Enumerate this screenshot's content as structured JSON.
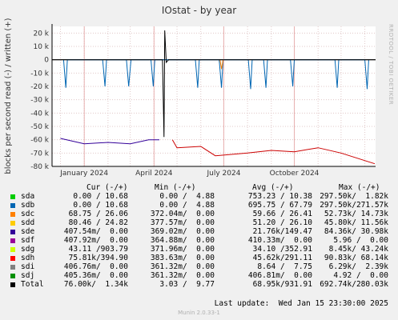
{
  "title": "IOstat - by year",
  "side_label": "RRDTOOL / TOBI OETIKER",
  "chart_data": {
    "type": "line",
    "title": "IOstat - by year",
    "ylabel": "blocks per second read (-) / written (+)",
    "ylim": [
      -80000,
      25000
    ],
    "y_ticks": [
      20000,
      10000,
      0,
      -10000,
      -20000,
      -30000,
      -40000,
      -50000,
      -60000,
      -70000,
      -80000
    ],
    "y_tick_labels": [
      "20 k",
      "10 k",
      "0",
      "-10 k",
      "-20 k",
      "-30 k",
      "-40 k",
      "-50 k",
      "-60 k",
      "-70 k",
      "-80 k"
    ],
    "x_tick_labels": [
      "January 2024",
      "April 2024",
      "July 2024",
      "October 2024"
    ],
    "x_range": [
      "2023-11-20",
      "2025-01-15"
    ],
    "grid": true,
    "series": [
      {
        "name": "sdh",
        "color": "#CC0000",
        "points": [
          [
            "2024-04-25",
            -60000
          ],
          [
            "2024-05-01",
            -66000
          ],
          [
            "2024-06-01",
            -65000
          ],
          [
            "2024-06-20",
            -72000
          ],
          [
            "2024-08-01",
            -70000
          ],
          [
            "2024-09-01",
            -68000
          ],
          [
            "2024-10-01",
            -69000
          ],
          [
            "2024-11-01",
            -66000
          ],
          [
            "2024-12-01",
            -70000
          ],
          [
            "2025-01-14",
            -78000
          ]
        ]
      },
      {
        "name": "sde",
        "color": "#330099",
        "points": [
          [
            "2023-12-01",
            -59000
          ],
          [
            "2024-01-01",
            -63000
          ],
          [
            "2024-02-01",
            -62000
          ],
          [
            "2024-03-01",
            -63000
          ],
          [
            "2024-03-25",
            -60000
          ],
          [
            "2024-04-08",
            -60000
          ]
        ]
      },
      {
        "name": "sdb",
        "color": "#0066B3",
        "points": [
          [
            "2023-12-05",
            0
          ],
          [
            "2023-12-08",
            -21000
          ],
          [
            "2023-12-10",
            0
          ],
          [
            "2024-01-25",
            0
          ],
          [
            "2024-01-28",
            -20000
          ],
          [
            "2024-01-30",
            0
          ],
          [
            "2024-02-25",
            0
          ],
          [
            "2024-02-28",
            -20000
          ],
          [
            "2024-03-02",
            0
          ],
          [
            "2024-03-28",
            0
          ],
          [
            "2024-03-31",
            -20000
          ],
          [
            "2024-04-02",
            0
          ],
          [
            "2024-05-25",
            0
          ],
          [
            "2024-05-28",
            -21000
          ],
          [
            "2024-05-30",
            0
          ],
          [
            "2024-06-25",
            0
          ],
          [
            "2024-06-28",
            -21000
          ],
          [
            "2024-06-30",
            0
          ],
          [
            "2024-08-02",
            0
          ],
          [
            "2024-08-05",
            -22000
          ],
          [
            "2024-08-07",
            0
          ],
          [
            "2024-08-22",
            0
          ],
          [
            "2024-08-25",
            -21000
          ],
          [
            "2024-08-27",
            0
          ],
          [
            "2024-09-26",
            0
          ],
          [
            "2024-09-29",
            -20000
          ],
          [
            "2024-10-01",
            0
          ],
          [
            "2024-11-23",
            0
          ],
          [
            "2024-11-26",
            -21000
          ],
          [
            "2024-11-28",
            0
          ],
          [
            "2025-01-01",
            0
          ],
          [
            "2025-01-04",
            -22000
          ],
          [
            "2025-01-06",
            0
          ]
        ]
      },
      {
        "name": "sdc",
        "color": "#FF8000",
        "points": [
          [
            "2024-06-26",
            0
          ],
          [
            "2024-06-28",
            -7000
          ],
          [
            "2024-06-30",
            0
          ]
        ]
      },
      {
        "name": "Total",
        "color": "#000000",
        "points": [
          [
            "2023-11-20",
            0
          ],
          [
            "2024-04-12",
            0
          ],
          [
            "2024-04-14",
            -58000
          ],
          [
            "2024-04-15",
            22000
          ],
          [
            "2024-04-17",
            -2000
          ],
          [
            "2024-04-20",
            0
          ],
          [
            "2025-01-15",
            0
          ]
        ]
      }
    ]
  },
  "legend": {
    "header": {
      "cur": "Cur (-/+)",
      "min": "Min (-/+)",
      "avg": "Avg (-/+)",
      "max": "Max (-/+)"
    },
    "rows": [
      {
        "name": "sda",
        "color": "#00CC00",
        "cur": "0.00 / 10.68",
        "min": "0.00 /  4.88",
        "avg": "753.23 / 10.38",
        "max": "297.50k/  1.82k"
      },
      {
        "name": "sdb",
        "color": "#0066B3",
        "cur": "0.00 / 10.68",
        "min": "0.00 /  4.88",
        "avg": "695.75 / 67.79",
        "max": "297.50k/271.57k"
      },
      {
        "name": "sdc",
        "color": "#FF8000",
        "cur": "68.75 / 26.06",
        "min": "372.04m/  0.00",
        "avg": "59.66 / 26.41",
        "max": "52.73k/ 14.73k"
      },
      {
        "name": "sdd",
        "color": "#FFCC00",
        "cur": "80.46 / 24.82",
        "min": "377.57m/  0.00",
        "avg": "51.20 / 26.10",
        "max": "45.80k/ 11.56k"
      },
      {
        "name": "sde",
        "color": "#330099",
        "cur": "407.54m/  0.00",
        "min": "369.02m/  0.00",
        "avg": "21.76k/149.47",
        "max": "84.36k/ 30.98k"
      },
      {
        "name": "sdf",
        "color": "#990099",
        "cur": "407.92m/  0.00",
        "min": "364.88m/  0.00",
        "avg": "410.33m/  0.00",
        "max": "5.96 /  0.00"
      },
      {
        "name": "sdg",
        "color": "#CCFF00",
        "cur": "43.11 /903.79",
        "min": "371.96m/  0.00",
        "avg": "34.10 /352.91",
        "max": "8.45k/ 43.24k"
      },
      {
        "name": "sdh",
        "color": "#FF0000",
        "cur": "75.81k/394.90",
        "min": "383.63m/  0.00",
        "avg": "45.62k/291.11",
        "max": "90.83k/ 68.14k"
      },
      {
        "name": "sdi",
        "color": "#808080",
        "cur": "406.76m/  0.00",
        "min": "361.32m/  0.00",
        "avg": "8.64 /  7.75",
        "max": "6.29k/  2.39k"
      },
      {
        "name": "sdj",
        "color": "#008F00",
        "cur": "405.36m/  0.00",
        "min": "361.32m/  0.00",
        "avg": "406.81m/  0.00",
        "max": "4.92 /  0.00"
      },
      {
        "name": "Total",
        "color": "#000000",
        "cur": "76.00k/  1.34k",
        "min": "3.03 /  9.77",
        "avg": "68.95k/931.91",
        "max": "692.74k/280.03k"
      }
    ]
  },
  "last_update": "Last update:  Wed Jan 15 23:30:00 2025",
  "footer": "Munin 2.0.33-1"
}
